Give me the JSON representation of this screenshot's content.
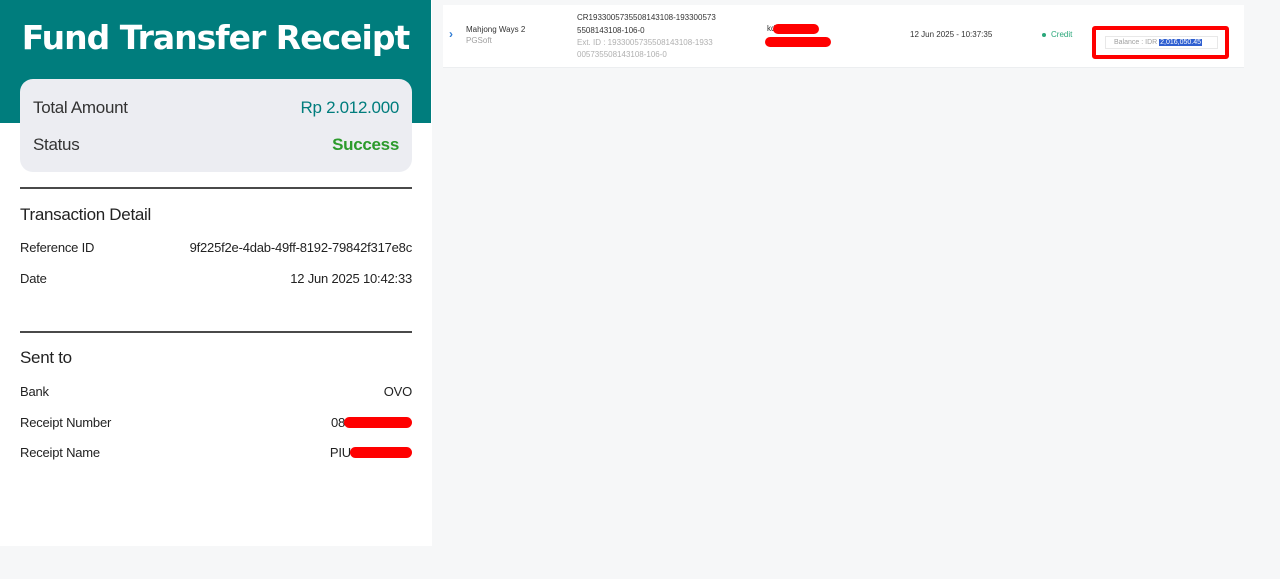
{
  "receipt": {
    "title": "Fund Transfer Receipt",
    "summary": {
      "total_amount_label": "Total Amount",
      "total_amount_value": "Rp 2.012.000",
      "status_label": "Status",
      "status_value": "Success"
    },
    "transaction_detail": {
      "title": "Transaction Detail",
      "reference_id_label": "Reference ID",
      "reference_id_value": "9f225f2e-4dab-49ff-8192-79842f317e8c",
      "date_label": "Date",
      "date_value": "12 Jun 2025 10:42:33"
    },
    "sent_to": {
      "title": "Sent to",
      "bank_label": "Bank",
      "bank_value": "OVO",
      "receipt_number_label": "Receipt Number",
      "receipt_number_visible": "08",
      "receipt_name_label": "Receipt Name",
      "receipt_name_visible": "PIU"
    }
  },
  "transaction": {
    "game": "Mahjong Ways 2",
    "provider": "PGSoft",
    "id": "CR193300573550814310­8-193300573550814310 8-106-0",
    "id_text": "CR1933005735508143108-1933005735508143108-106-0",
    "ext_id": "Ext. ID : 1933005735508143108-1933005735508143108-106-0",
    "user_visible": "kd",
    "datetime": "12 Jun 2025 - 10:37:35",
    "type": "Credit",
    "balance_label": "Balance : IDR",
    "balance_value": "2,016,050.45"
  },
  "colors": {
    "teal": "#007d7d",
    "success_green": "#2c9b2c",
    "redaction": "#ff0000",
    "credit_green": "#2aa77a",
    "selection_blue": "#2f5fd0"
  },
  "icons": {
    "expand": "chevron-right-icon",
    "credit_dot": "status-dot-icon"
  }
}
